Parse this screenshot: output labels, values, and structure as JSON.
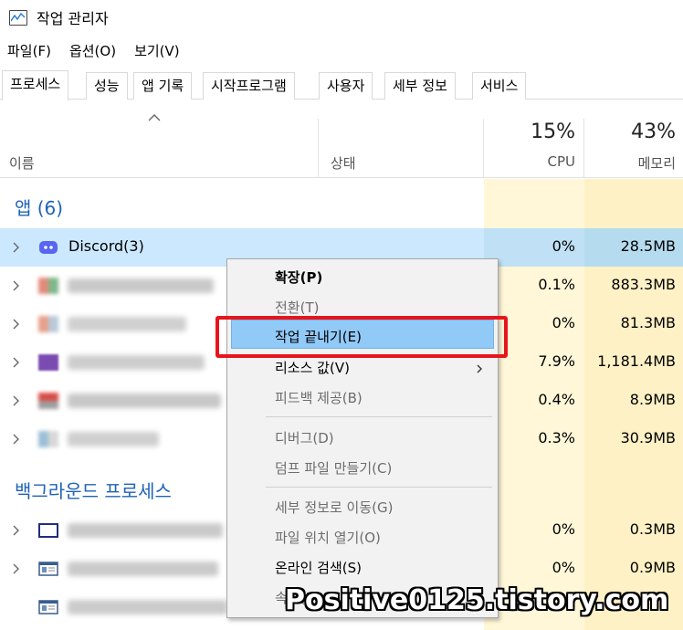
{
  "window": {
    "title": "작업 관리자"
  },
  "menu": [
    "파일(F)",
    "옵션(O)",
    "보기(V)"
  ],
  "tabs": [
    "프로세스",
    "성능",
    "앱 기록",
    "시작프로그램",
    "사용자",
    "세부 정보",
    "서비스"
  ],
  "header": {
    "name_label": "이름",
    "status_label": "상태",
    "cpu_pct": "15%",
    "cpu_label": "CPU",
    "mem_pct": "43%",
    "mem_label": "메모리"
  },
  "groups": {
    "apps_title": "앱 (6)",
    "background_title": "백그라운드 프로세스"
  },
  "apps": [
    {
      "name": "Discord(3)",
      "cpu": "0%",
      "mem": "28.5MB",
      "icon": "discord-icon",
      "color": "#5865f2"
    },
    {
      "name": "",
      "cpu": "0.1%",
      "mem": "883.3MB",
      "icon": "blurred-icon",
      "color": "#7fb88a"
    },
    {
      "name": "",
      "cpu": "0%",
      "mem": "81.3MB",
      "icon": "blurred-icon",
      "color": "#e7a08a"
    },
    {
      "name": "",
      "cpu": "7.9%",
      "mem": "1,181.4MB",
      "icon": "blurred-icon",
      "color": "#7a4bb0"
    },
    {
      "name": "",
      "cpu": "0.4%",
      "mem": "8.9MB",
      "icon": "blurred-icon",
      "color": "#d94a45"
    },
    {
      "name": "",
      "cpu": "0.3%",
      "mem": "30.9MB",
      "icon": "blurred-icon",
      "color": "#9bbfd6"
    }
  ],
  "background": [
    {
      "cpu": "0%",
      "mem": "0.3MB",
      "icon": "window-icon"
    },
    {
      "cpu": "0%",
      "mem": "0.9MB",
      "icon": "app-window-icon"
    },
    {
      "cpu": "",
      "mem": "",
      "icon": "app-window-icon"
    }
  ],
  "context_menu": {
    "items": [
      {
        "label": "확장(P)",
        "style": "bold"
      },
      {
        "label": "전환(T)",
        "style": "disabled"
      },
      {
        "label": "작업 끝내기(E)",
        "style": "hover"
      },
      {
        "label": "리소스 값(V)",
        "style": "normal",
        "submenu": true
      },
      {
        "label": "피드백 제공(B)",
        "style": "disabled"
      },
      {
        "label": "디버그(D)",
        "style": "disabled"
      },
      {
        "label": "덤프 파일 만들기(C)",
        "style": "disabled"
      },
      {
        "label": "세부 정보로 이동(G)",
        "style": "disabled"
      },
      {
        "label": "파일 위치 열기(O)",
        "style": "disabled"
      },
      {
        "label": "온라인 검색(S)",
        "style": "normal"
      },
      {
        "label": "속성(I)",
        "style": "disabled"
      }
    ]
  },
  "watermark": "Positive0125.tistory.com",
  "colors": {
    "highlight": "#cce8ff",
    "cpu_col": "#fff7d8",
    "mem_col": "#fff1c6",
    "accent_red": "#e8141c",
    "group_blue": "#1f63b6"
  }
}
